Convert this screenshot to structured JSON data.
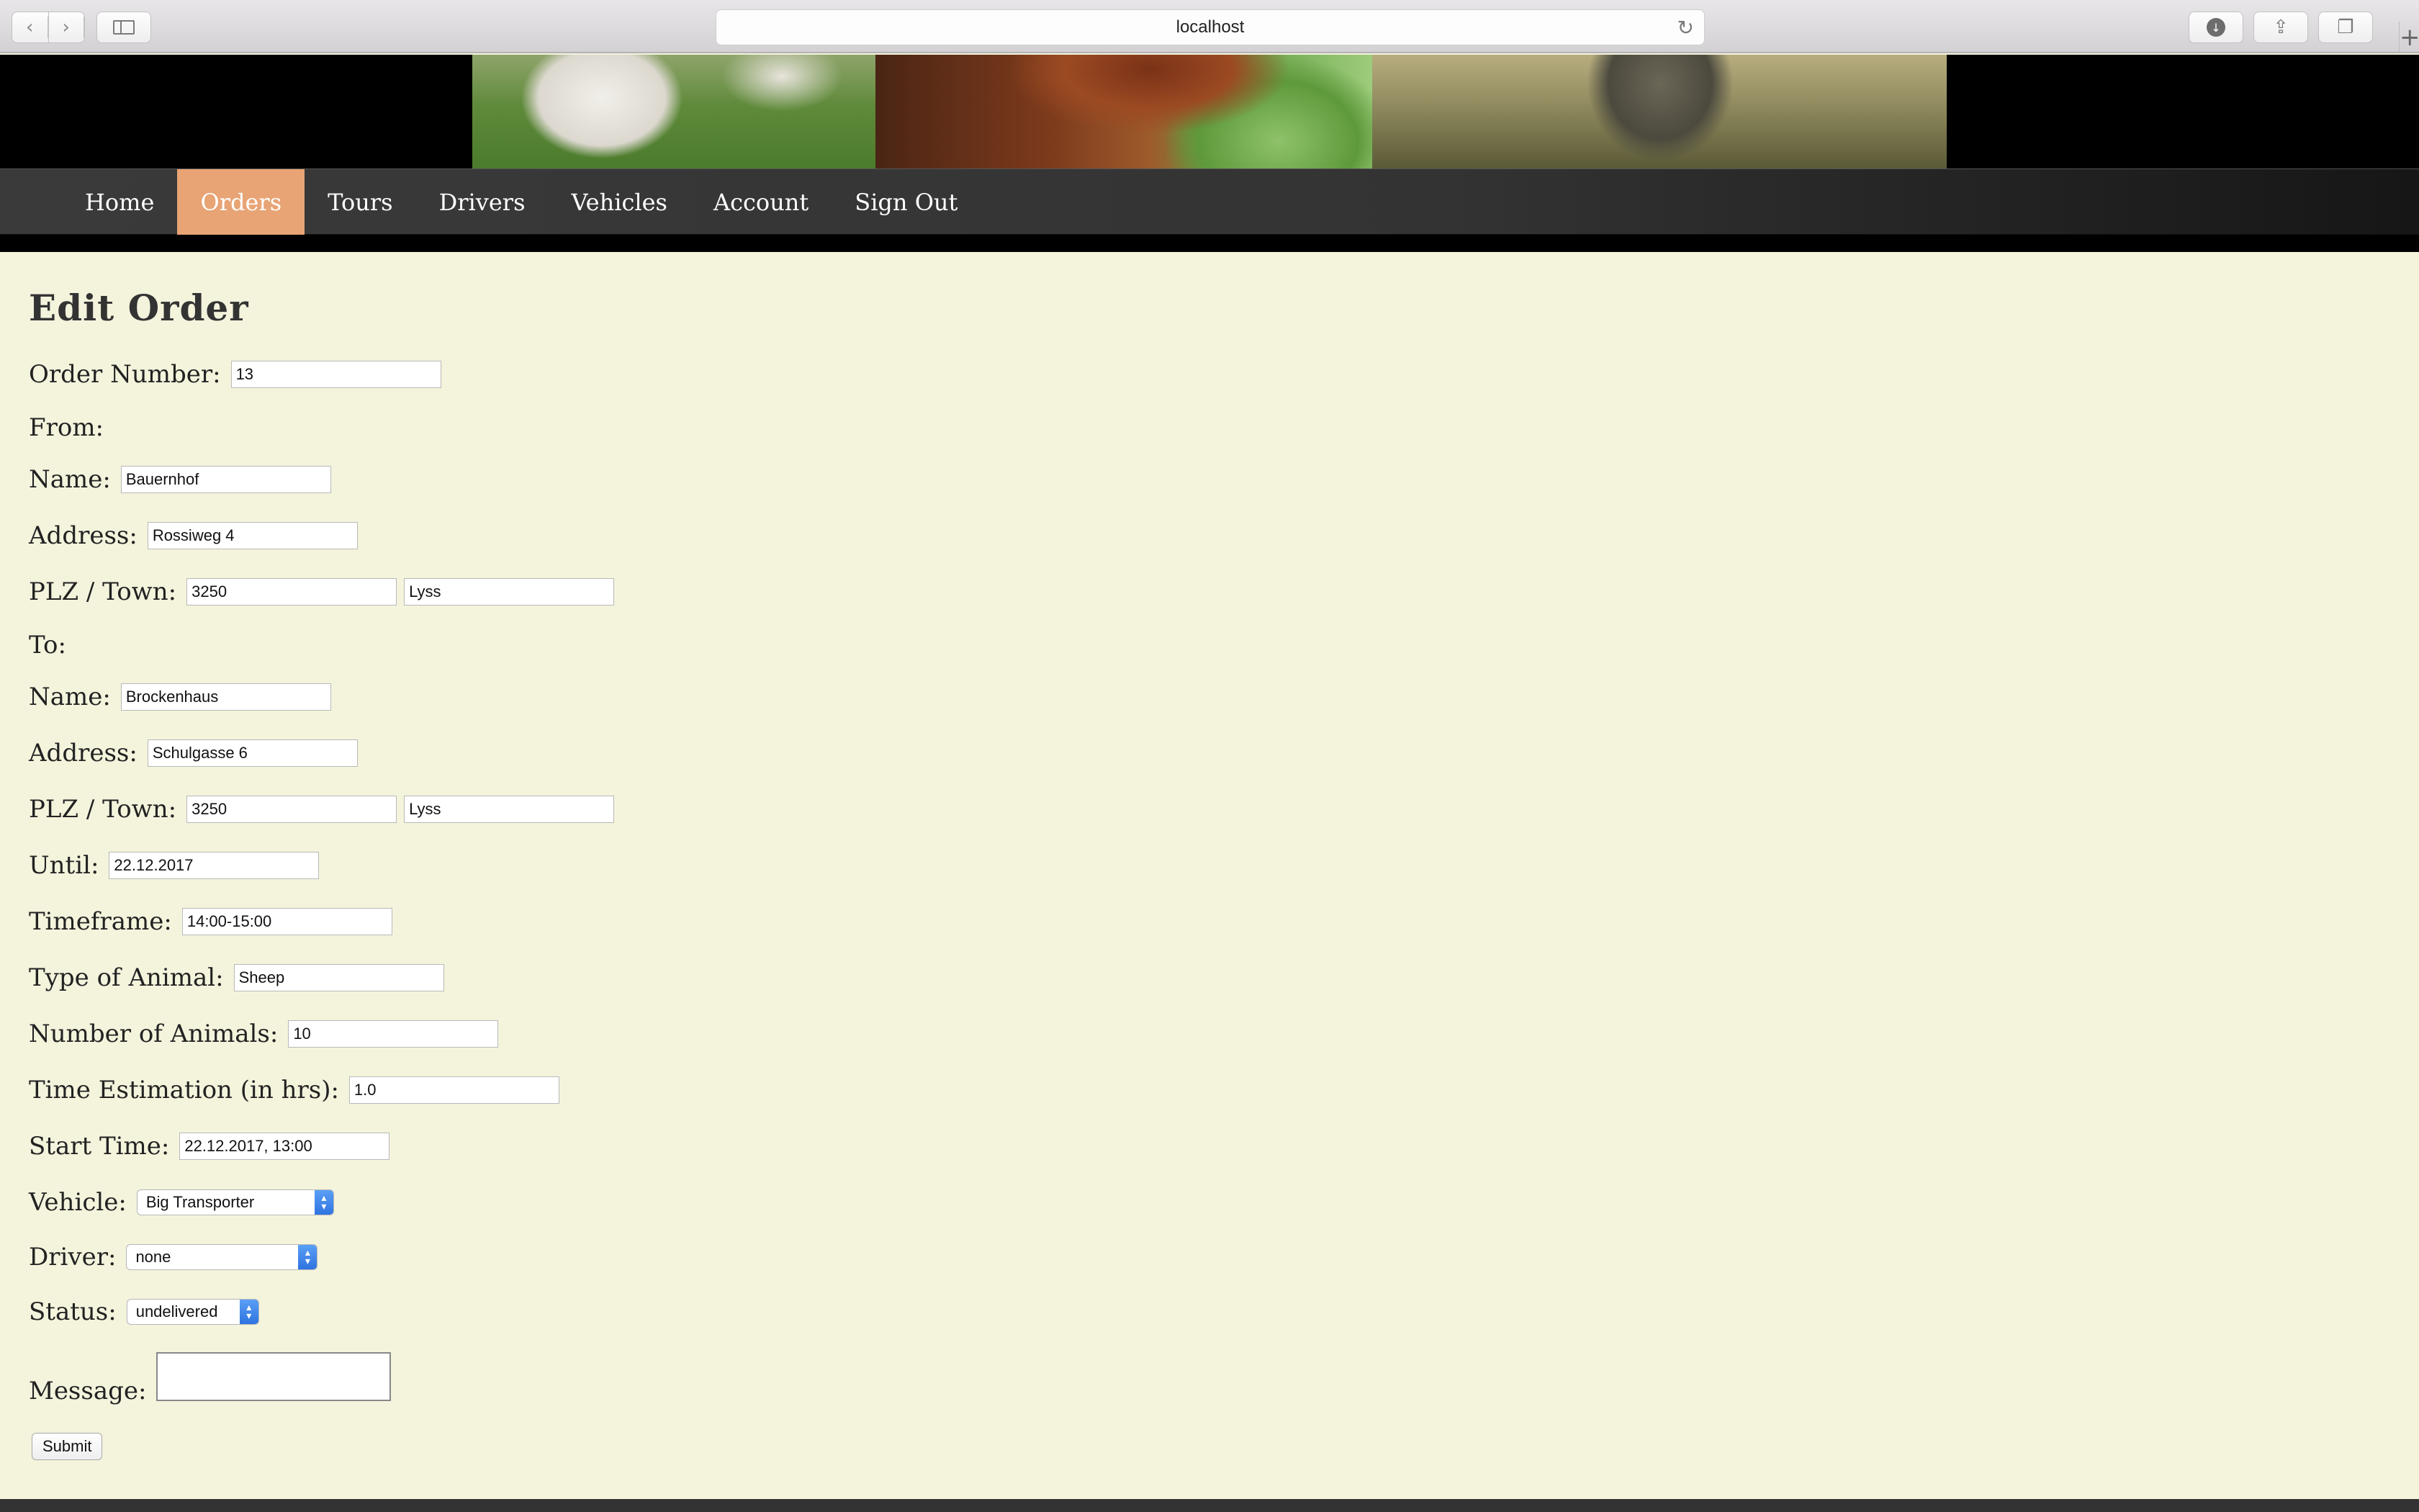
{
  "browser": {
    "url": "localhost",
    "back_icon": "chevron-left-icon",
    "forward_icon": "chevron-right-icon",
    "sidebar_icon": "sidebar-icon",
    "reload_icon": "reload-icon",
    "download_icon": "download-icon",
    "share_icon": "share-icon",
    "tabs_icon": "tabs-icon",
    "new_tab_glyph": "+"
  },
  "nav": {
    "items": [
      {
        "label": "Home"
      },
      {
        "label": "Orders"
      },
      {
        "label": "Tours"
      },
      {
        "label": "Drivers"
      },
      {
        "label": "Vehicles"
      },
      {
        "label": "Account"
      },
      {
        "label": "Sign Out"
      }
    ],
    "active_index": 1,
    "active_color": "#e8a475"
  },
  "form": {
    "title": "Edit Order",
    "order_number": {
      "label": "Order Number:",
      "value": "13"
    },
    "from_heading": "From:",
    "from": {
      "name": {
        "label": "Name:",
        "value": "Bauernhof"
      },
      "address": {
        "label": "Address:",
        "value": "Rossiweg 4"
      },
      "plz_town": {
        "label": "PLZ / Town:",
        "plz": "3250",
        "town": "Lyss"
      }
    },
    "to_heading": "To:",
    "to": {
      "name": {
        "label": "Name:",
        "value": "Brockenhaus"
      },
      "address": {
        "label": "Address:",
        "value": "Schulgasse 6"
      },
      "plz_town": {
        "label": "PLZ / Town:",
        "plz": "3250",
        "town": "Lyss"
      }
    },
    "until": {
      "label": "Until:",
      "value": "22.12.2017"
    },
    "timeframe": {
      "label": "Timeframe:",
      "value": "14:00-15:00"
    },
    "animal_type": {
      "label": "Type of Animal:",
      "value": "Sheep"
    },
    "animal_count": {
      "label": "Number of Animals:",
      "value": "10"
    },
    "time_estimation": {
      "label": "Time Estimation (in hrs):",
      "value": "1.0"
    },
    "start_time": {
      "label": "Start Time:",
      "value": "22.12.2017, 13:00"
    },
    "vehicle": {
      "label": "Vehicle:",
      "selected": "Big Transporter"
    },
    "driver": {
      "label": "Driver:",
      "selected": "none"
    },
    "status": {
      "label": "Status:",
      "selected": "undelivered"
    },
    "message": {
      "label": "Message:",
      "value": ""
    },
    "submit_label": "Submit"
  },
  "colors": {
    "page_bg": "#f4f3dc",
    "header_bg": "#000000",
    "navbar_bg": "#333333",
    "select_accent": "#3b82f0"
  }
}
